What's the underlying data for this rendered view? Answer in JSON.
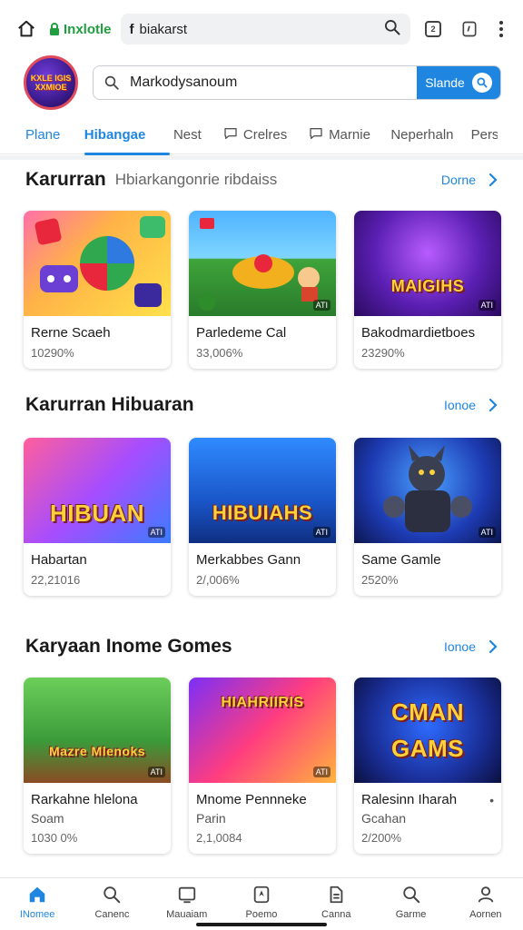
{
  "browser": {
    "site_name": "Inxlotle",
    "url_prefix": "f",
    "url": "biakarst",
    "tab_count": "2"
  },
  "header": {
    "logo_lines": [
      "KXLE IGIS",
      "XXMIOE"
    ],
    "search_value": "Markodysanoum",
    "search_button": "Slande"
  },
  "tabs": [
    {
      "label": "Plane"
    },
    {
      "label": "Hibangae"
    },
    {
      "label": "Nest"
    },
    {
      "label": "Crelres"
    },
    {
      "label": "Marnie"
    },
    {
      "label": "Neperhaln"
    },
    {
      "label": "Pers"
    }
  ],
  "sections": [
    {
      "title": "Karurran",
      "subtitle": "Hbiarkangonrie ribdaiss",
      "more": "Dorne",
      "cards": [
        {
          "name": "Rerne Scaeh",
          "sub": "",
          "meta": "10290%",
          "thumb_text": "",
          "badge": ""
        },
        {
          "name": "Parledeme Cal",
          "sub": "",
          "meta": "33,006%",
          "thumb_text": "",
          "badge": "ATI"
        },
        {
          "name": "Bakodmardietboes",
          "sub": "",
          "meta": "23290%",
          "thumb_text": "MAIGIHS",
          "badge": "ATI"
        }
      ]
    },
    {
      "title": "Karurran Hibuaran",
      "subtitle": "",
      "more": "Ionoe",
      "cards": [
        {
          "name": "Habartan",
          "sub": "",
          "meta": "22,21016",
          "thumb_text": "HIBUAN",
          "badge": "ATI"
        },
        {
          "name": "Merkabbes Gann",
          "sub": "",
          "meta": "2/,006%",
          "thumb_text": "HIBUIAHS",
          "badge": "ATI"
        },
        {
          "name": "Same Gamle",
          "sub": "",
          "meta": "2520%",
          "thumb_text": "",
          "badge": "ATI"
        }
      ]
    },
    {
      "title": "Karyaan Inome Gomes",
      "subtitle": "",
      "more": "Ionoe",
      "cards": [
        {
          "name": "Rarkahne hlelona",
          "sub": "Soam",
          "meta": "1030 0%",
          "thumb_text": "Mazre Mlenoks",
          "badge": "ATI"
        },
        {
          "name": "Mnome Pennneke",
          "sub": "Parin",
          "meta": "2,1,0084",
          "thumb_text": "HIAHRIIRIS",
          "badge": "ATI"
        },
        {
          "name": "Ralesinn Iharah",
          "sub": "Gcahan",
          "meta": "2/200%",
          "thumb_text": "CMAN GAMS",
          "badge": ""
        }
      ]
    }
  ],
  "bottom_nav": [
    {
      "label": "INomee",
      "icon": "home-icon"
    },
    {
      "label": "Canenc",
      "icon": "search-icon"
    },
    {
      "label": "Mauaiam",
      "icon": "tv-icon"
    },
    {
      "label": "Poemo",
      "icon": "compass-icon"
    },
    {
      "label": "Canna",
      "icon": "document-icon"
    },
    {
      "label": "Garme",
      "icon": "search-icon"
    },
    {
      "label": "Aornen",
      "icon": "person-icon"
    }
  ],
  "colors": {
    "accent": "#1e86e0",
    "secure_green": "#1e9e3e"
  }
}
